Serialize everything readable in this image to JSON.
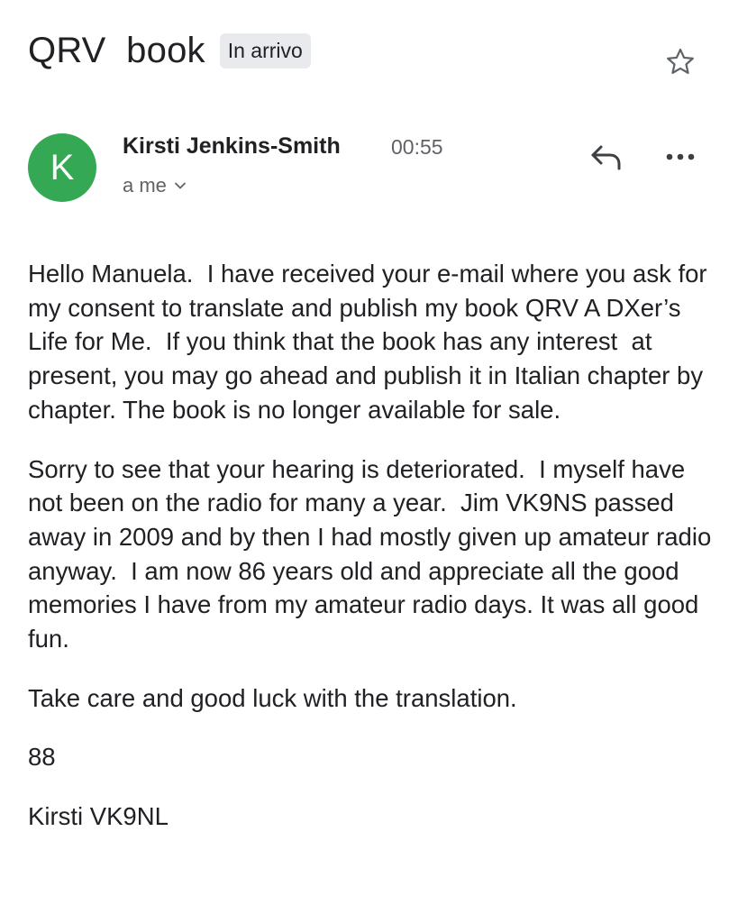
{
  "email": {
    "subject": "QRV  book",
    "label": "In arrivo",
    "sender": {
      "initial": "K",
      "name": "Kirsti Jenkins-Smith",
      "time": "00:55",
      "recipients": "a me"
    },
    "body": {
      "paragraph_1": "Hello Manuela.  I have received your e-mail where you ask for my consent to translate and publish my book QRV A DXer’s Life for Me.  If you think that the book has any interest  at present, you may go ahead and publish it in Italian chapter by chapter. The book is no longer available for sale.",
      "paragraph_2": "Sorry to see that your hearing is deteriorated.  I myself have not been on the radio for many a year.  Jim VK9NS passed away in 2009 and by then I had mostly given up amateur radio anyway.  I am now 86 years old and appreciate all the good memories I have from my amateur radio days. It was all good fun.",
      "paragraph_3": "Take care and good luck with the translation.",
      "paragraph_4": "88",
      "paragraph_5": "Kirsti VK9NL"
    }
  },
  "icons": {
    "star": "star-outline-icon",
    "reply": "reply-arrow-icon",
    "more": "more-horizontal-icon",
    "chevron": "chevron-down-icon"
  },
  "colors": {
    "avatar": "#34a853",
    "label_chip": "#e8eaed",
    "secondary_text": "#5f6368"
  }
}
